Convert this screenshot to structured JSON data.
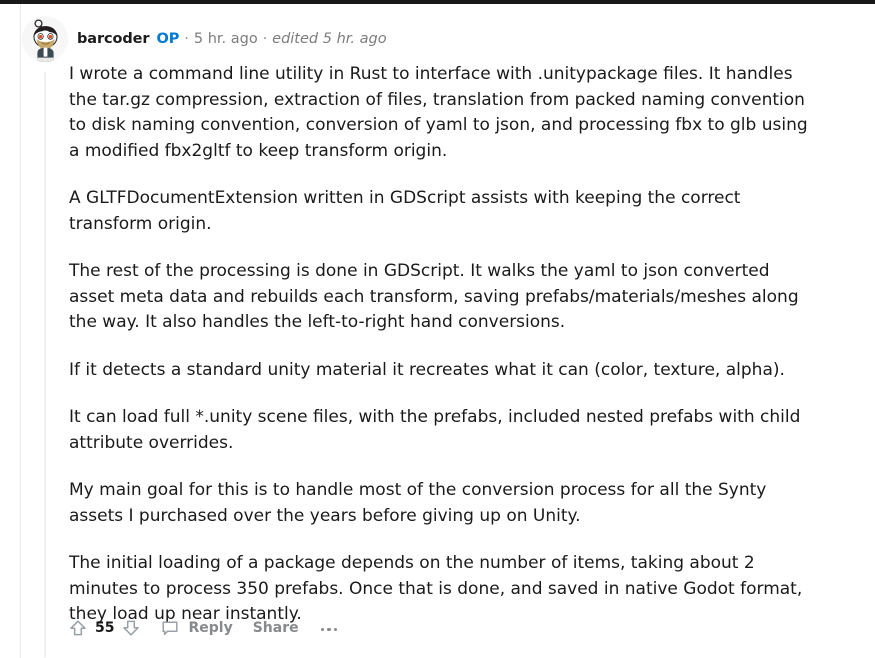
{
  "comment": {
    "author": "barcoder",
    "op_badge": "OP",
    "separator": "·",
    "timestamp": "5 hr. ago",
    "edited": "edited 5 hr. ago",
    "avatar_icon": "reddit-snoo-avatar",
    "paragraphs": [
      "I wrote a command line utility in Rust to interface with .unitypackage files. It handles the tar.gz compression, extraction of files, translation from packed naming convention to disk naming convention, conversion of yaml to json, and processing fbx to glb using a modified fbx2gltf to keep transform origin.",
      "A GLTFDocumentExtension written in GDScript assists with keeping the correct transform origin.",
      "The rest of the processing is done in GDScript. It walks the yaml to json converted asset meta data and rebuilds each transform, saving prefabs/materials/meshes along the way. It also handles the left-to-right hand conversions.",
      "If it detects a standard unity material it recreates what it can (color, texture, alpha).",
      "It can load full *.unity scene files, with the prefabs, included nested prefabs with child attribute overrides.",
      "My main goal for this is to handle most of the conversion process for all the Synty assets I purchased over the years before giving up on Unity.",
      "The initial loading of a package depends on the number of items, taking about 2 minutes to process 350 prefabs. Once that is done, and saved in native Godot format, they load up near instantly."
    ]
  },
  "actions": {
    "upvote_icon": "upvote-arrow-icon",
    "score": "55",
    "downvote_icon": "downvote-arrow-icon",
    "comment_icon": "comment-bubble-icon",
    "reply_label": "Reply",
    "share_label": "Share",
    "more_icon": "more-options-icon"
  },
  "colors": {
    "op_blue": "#0079d3",
    "body_text": "#1a1a1b",
    "meta_text": "#7c7c7c",
    "action_text": "#878a8c",
    "thread_line": "#f0f0f0",
    "top_bar": "#181818"
  }
}
